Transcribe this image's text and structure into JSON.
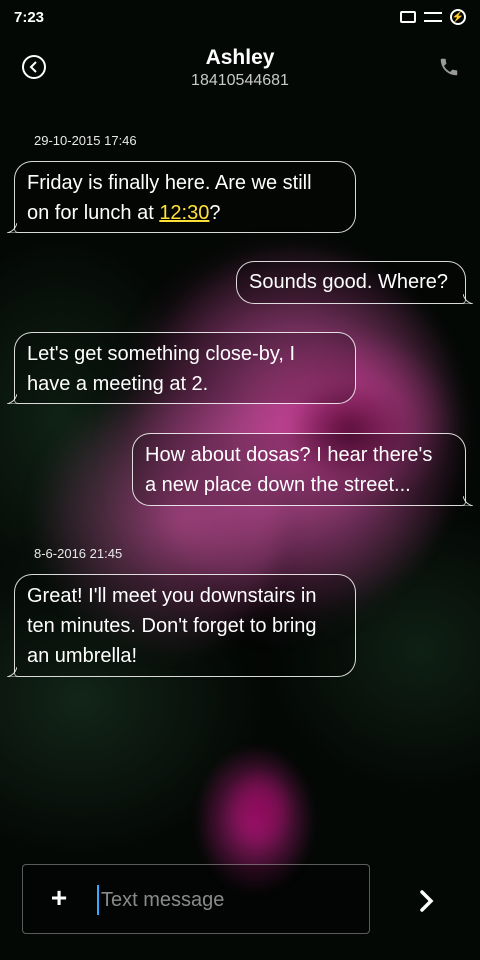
{
  "status_bar": {
    "time": "7:23",
    "icons": [
      "battery-outline-icon",
      "signal-lines-icon",
      "charging-icon"
    ]
  },
  "header": {
    "contact_name": "Ashley",
    "contact_number": "18410544681",
    "back_icon": "back-icon",
    "call_icon": "phone-icon"
  },
  "conversation": {
    "groups": [
      {
        "timestamp": "29-10-2015 17:46",
        "messages": [
          {
            "direction": "incoming",
            "lines": [
              "Friday is finally here. Are we still",
              "on for lunch at "
            ],
            "link": "12:30",
            "after_link": "?"
          },
          {
            "direction": "outgoing",
            "text": "Sounds good. Where?"
          },
          {
            "direction": "incoming",
            "lines": [
              "Let's get something close-by, I",
              "have a meeting at 2."
            ]
          },
          {
            "direction": "outgoing",
            "lines": [
              "How about dosas? I hear there's",
              "a new place down the street..."
            ]
          }
        ]
      },
      {
        "timestamp": "8-6-2016 21:45",
        "messages": [
          {
            "direction": "incoming",
            "lines": [
              "Great! I'll meet you downstairs in",
              "ten minutes. Don't forget to bring",
              "an umbrella!"
            ]
          }
        ]
      }
    ]
  },
  "composer": {
    "attach_label": "+",
    "placeholder": "Text message",
    "send_icon": "chevron-right-icon"
  },
  "colors": {
    "link": "#ffe03a",
    "cursor": "#3aa9ff"
  }
}
